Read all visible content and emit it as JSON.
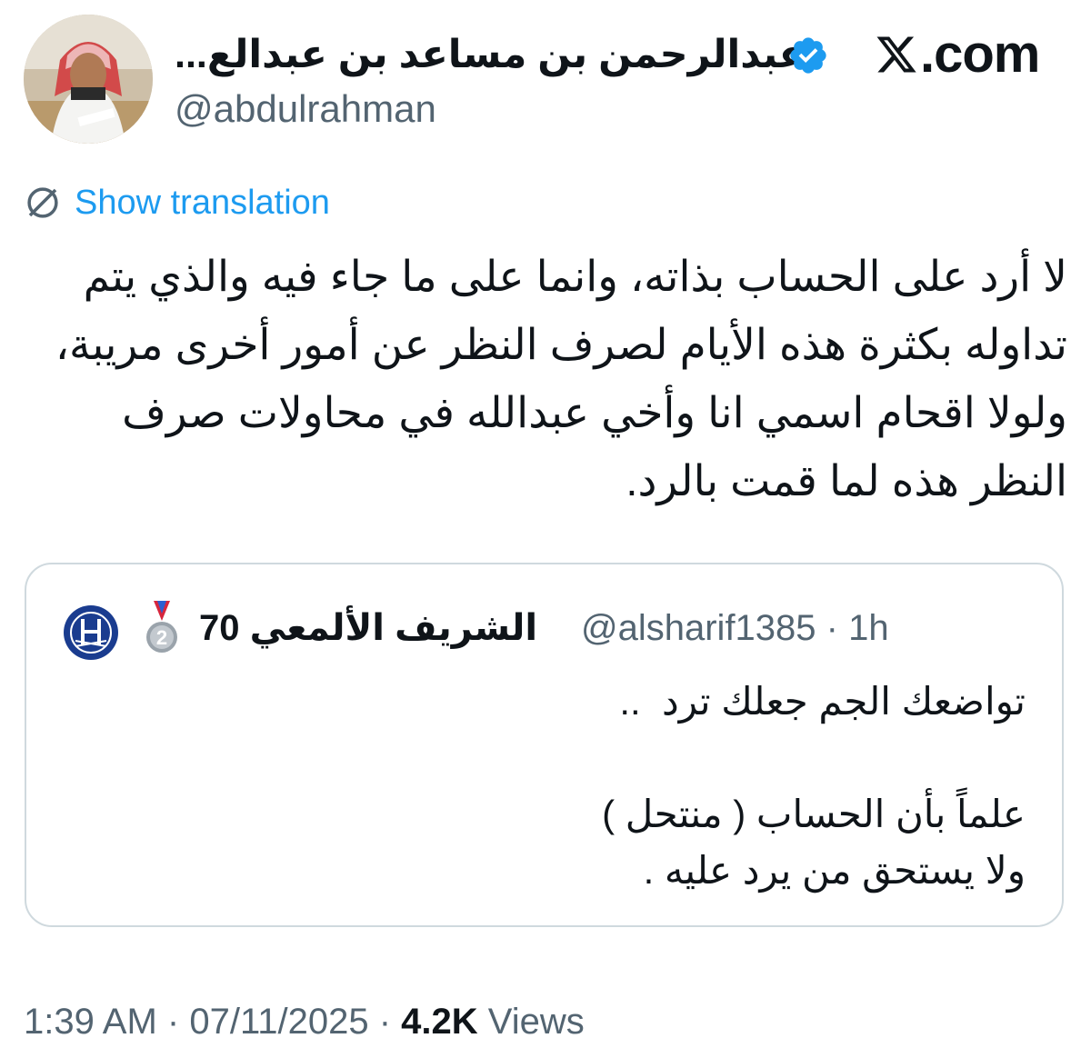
{
  "brand": {
    "logo_icon": "x-logo-icon",
    "text": ".com"
  },
  "author": {
    "display_name": "عبدالرحمن بن مساعد بن عبدالع...",
    "handle": "@abdulrahman",
    "verified_icon": "verified-badge-icon",
    "verified_color": "#1d9bf0"
  },
  "translation": {
    "icon": "globe-icon",
    "link_label": "Show translation",
    "link_color": "#1d9bf0"
  },
  "tweet": {
    "lines": [
      "لا أرد على الحساب بذاته، وانما على ما جاء فيه والذي يتم",
      "تداوله بكثرة هذه الأيام لصرف النظر عن أمور أخرى مريبة،",
      "ولولا اقحام اسمي انا وأخي عبدالله في محاولات صرف",
      "النظر هذه لما قمت بالرد."
    ]
  },
  "quoted_tweet": {
    "avatar_icon": "club-logo-icon",
    "badge_icon": "silver-medal-icon",
    "badge_number": "2",
    "display_name": "الشريف الألمعي 70",
    "handle": "@alsharif1385",
    "separator": "·",
    "time": "1h",
    "lines": [
      "تواضعك الجم جعلك ترد  ..",
      "",
      "علماً بأن الحساب ( منتحل )",
      "ولا يستحق من يرد عليه ."
    ]
  },
  "footer": {
    "time": "1:39 AM",
    "separator": "·",
    "date": "07/11/2025",
    "views_count": "4.2K",
    "views_label": "Views"
  }
}
